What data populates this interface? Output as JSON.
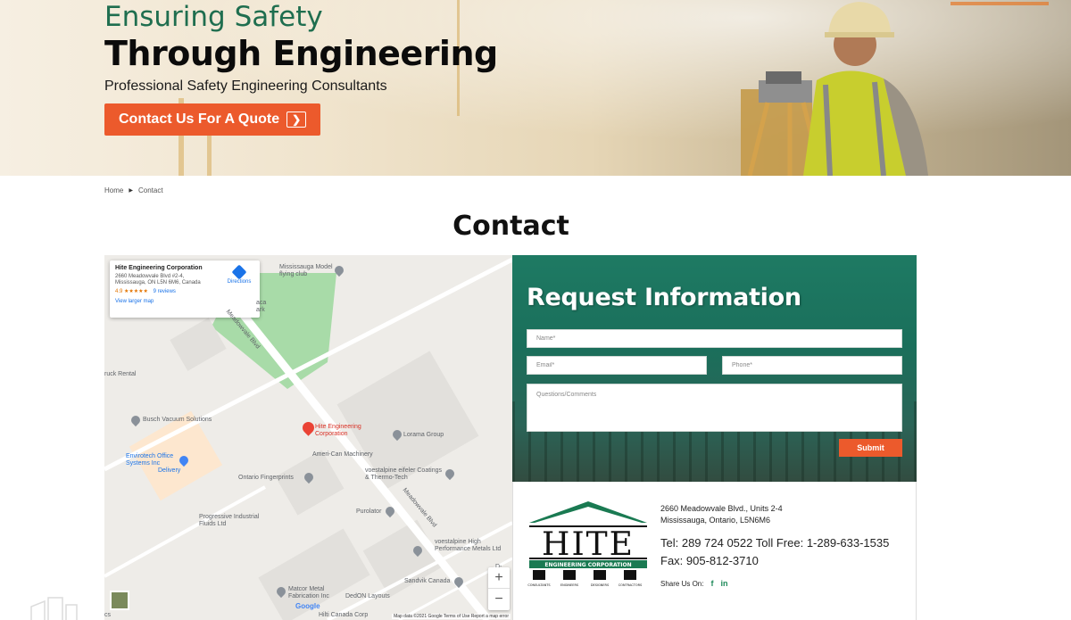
{
  "hero": {
    "title_line1": "Ensuring Safety",
    "title_line2": "Through Engineering",
    "subtitle": "Professional Safety Engineering Consultants",
    "cta_label": "Contact Us For A Quote",
    "cta_icon": "chevron-right-icon",
    "accent_color": "#1f6e4f",
    "cta_color": "#ec5a2c"
  },
  "breadcrumb": {
    "home": "Home",
    "current": "Contact"
  },
  "page_title": "Contact",
  "map": {
    "card": {
      "name": "Hite Engineering Corporation",
      "address": "2660 Meadowvale Blvd #2-4, Mississauga, ON L5N 6M6, Canada",
      "rating": "4.9 ★★★★★",
      "reviews": "9 reviews",
      "larger_map": "View larger map",
      "directions": "Directions"
    },
    "labels": {
      "model_club": "Mississauga Model flying club",
      "truck_rental": "ruck Rental",
      "busch": "Busch Vacuum Solutions",
      "envirotech": "Envirotech Office Systems Inc",
      "envirotech_sub": "Delivery",
      "hite": "Hite Engineering Corporation",
      "lorama": "Lorama Group",
      "amer": "Ameri-Can Machinery",
      "ontario_fp": "Ontario Fingerprints",
      "voest1": "voestalpine eifeler Coatings & Thermo-Tech",
      "progressive": "Progressive Industrial Fluids Ltd",
      "purolator": "Purolator",
      "voest2": "voestalpine High Performance Metals Ltd",
      "sandvik": "Sandvik Canada",
      "matcor": "Matcor Metal Fabrication Inc",
      "dedon": "DedON Layouts",
      "hilti": "Hilti Canada Corp",
      "meadowvale1": "Meadowvale Blvd",
      "meadowvale2": "Meadowvale Blvd",
      "park": "aca ark",
      "cs": "cs",
      "dlink": "D-Link"
    },
    "zoom_in": "+",
    "zoom_out": "−",
    "google": "Google",
    "attribution": "Map data ©2021 Google    Terms of Use    Report a map error"
  },
  "form": {
    "title": "Request Information",
    "name_placeholder": "Name*",
    "email_placeholder": "Email*",
    "phone_placeholder": "Phone*",
    "comments_placeholder": "Questions/Comments",
    "submit_label": "Submit"
  },
  "contact": {
    "logo_text": "HITE",
    "logo_sub": "ENGINEERING CORPORATION",
    "logo_roles": [
      "CONSULTANTS",
      "ENGINEERS",
      "DESIGNERS",
      "CONTRACTORS"
    ],
    "address_line1": "2660 Meadowvale Blvd., Units 2-4",
    "address_line2": "Mississauga, Ontario, L5N6M6",
    "tel_line": "Tel: 289 724 0522  Toll Free: 1-289-633-1535",
    "fax_line": "Fax: 905-812-3710",
    "share_label": "Share Us On:",
    "facebook": "f",
    "linkedin": "in"
  }
}
